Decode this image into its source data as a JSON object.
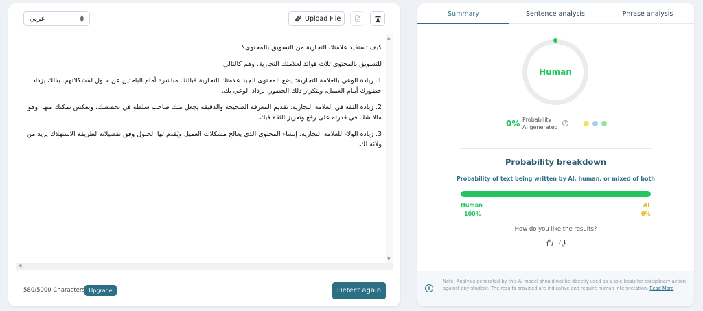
{
  "editor": {
    "language": "عربى",
    "upload_label": "Upload File",
    "paragraphs": [
      "كيف تستفيد علامتك التجارية من التسويق بالمحتوى؟",
      "للتسويق بالمحتوى ثلاث فوائد لعلامتك التجارية، وهم كالتالي:",
      "1. زيادة الوعي بالعلامة التجارية: يضع المحتوى الجيد علامتك التجارية قبالتك مباشرة أمام الباحثين عن حلول لمشكلاتهم. بذلك يزداد حضورك أمام العميل، وبتكرار ذلك الحضور، يزداد الوعي بك.",
      "2. زيادة الثقة في العلامة التجارية: تقديم المعرفة الصحيحة والدقيقة يجعل منك صاحب سلطة في تخصصك، ويعكس تمكنك منها، وهو مالا شك في قدرته على رفع وتعزيز الثقة فيك.",
      "3. زيادة الولاء للعلامة التجارية: إنشاء المحتوى الذي يعالج مشكلات العميل ويُقدم لها الحلول وفق تفضيلاته لطريقة الاستهلاك يزيد من ولائه لك."
    ],
    "char_count": "580/5000 Characters",
    "upgrade_label": "Upgrade",
    "detect_label": "Detect again"
  },
  "results": {
    "tabs": [
      "Summary",
      "Sentence analysis",
      "Phrase analysis"
    ],
    "active_tab": "Summary",
    "gauge_label": "Human",
    "ai_probability_pct": "0%",
    "ai_probability_label_1": "Probability",
    "ai_probability_label_2": "AI generated",
    "breakdown_title": "Probability breakdown",
    "breakdown_subtitle": "Probability of text being written by AI, human, or mixed of both",
    "human_label": "Human",
    "human_pct": "100%",
    "human_fraction": 1.0,
    "ai_label": "AI",
    "ai_pct": "0%",
    "question": "How do you like the results?",
    "note": "Note: Analysis generated by this AI model should not be directly used as a sole basis for disciplinary action against any student. The results provided are indicative and require human interpretation.",
    "note_link": "Read More"
  },
  "colors": {
    "accent": "#2d6f84",
    "human": "#22c55e",
    "ai": "#eab308",
    "mixed": "#86c9d6"
  }
}
